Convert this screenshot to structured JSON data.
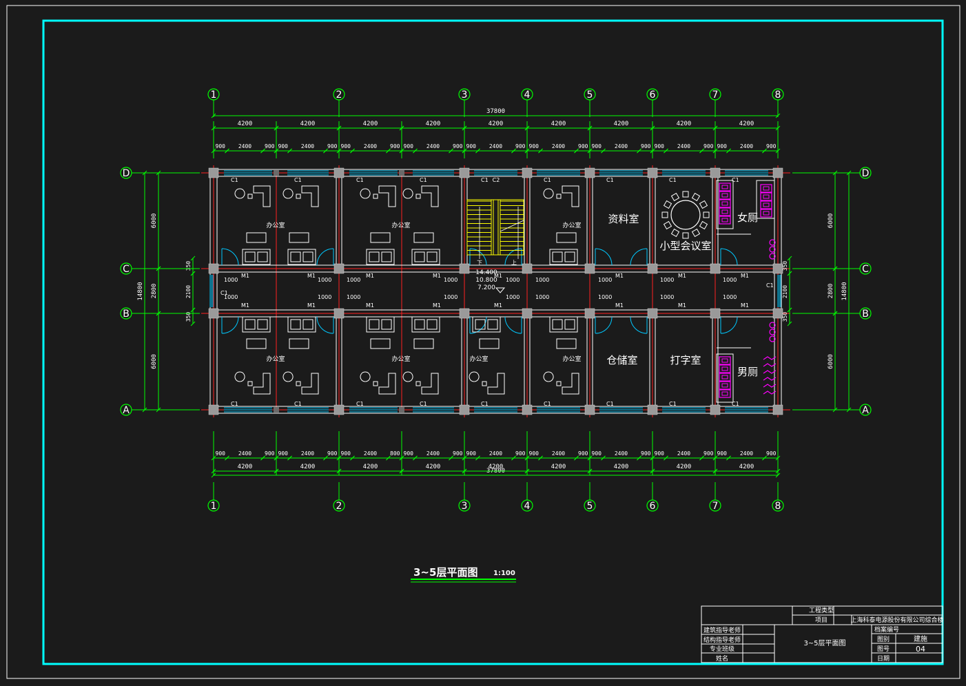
{
  "drawing": {
    "title": "3~5层平面图",
    "scale": "1:100",
    "overall_dim": "37800",
    "bay_dim": "4200",
    "sub_dims": [
      "900",
      "2400",
      "900"
    ],
    "sub_dims_bottom_third": [
      "900",
      "2400",
      "800"
    ],
    "axes_columns": [
      "1",
      "2",
      "3",
      "4",
      "5",
      "6",
      "7",
      "8"
    ],
    "axes_rows": [
      "D",
      "C",
      "B",
      "A"
    ],
    "row_dims_outer": [
      "14800"
    ],
    "row_dims_inner": [
      "6000",
      "2800",
      "6000"
    ],
    "row_dims_detail": [
      "350",
      "2100",
      "350"
    ],
    "elevations": [
      "14.400",
      "10.800",
      "7.200"
    ],
    "stair_labels": {
      "down": "下",
      "up": "上",
      "window": "C2"
    },
    "window_label": "C1",
    "door_label": "M1",
    "door_width_label": "1000",
    "rooms": {
      "office": "办公室",
      "archive": "资料室",
      "meeting": "小型会议室",
      "women_wc": "女厕",
      "storage": "仓储室",
      "typing": "打字室",
      "men_wc": "男厕"
    }
  },
  "title_block": {
    "project_type_label": "工程类型",
    "project_label": "项目",
    "project_name": "上海科泰电源股份有限公司综合楼",
    "archive_no_label": "档案编号",
    "rows_left": [
      "建筑指导老师",
      "结构指导老师",
      "专业班级",
      "姓名"
    ],
    "drawing_name": "3~5层平面图",
    "rows_right_labels": [
      "图别",
      "图号",
      "日期"
    ],
    "drawing_category": "建施",
    "drawing_number": "04",
    "date": ""
  },
  "colors": {
    "background": "#1b1b1b",
    "frame": "#00ffff",
    "dimension": "#00ff00",
    "axis_line": "#ff2020",
    "wall": "#ffffff",
    "column": "#9a9a9a",
    "stair": "#ffff00",
    "fixture": "#ff00ff",
    "window": "#00c8ff"
  }
}
